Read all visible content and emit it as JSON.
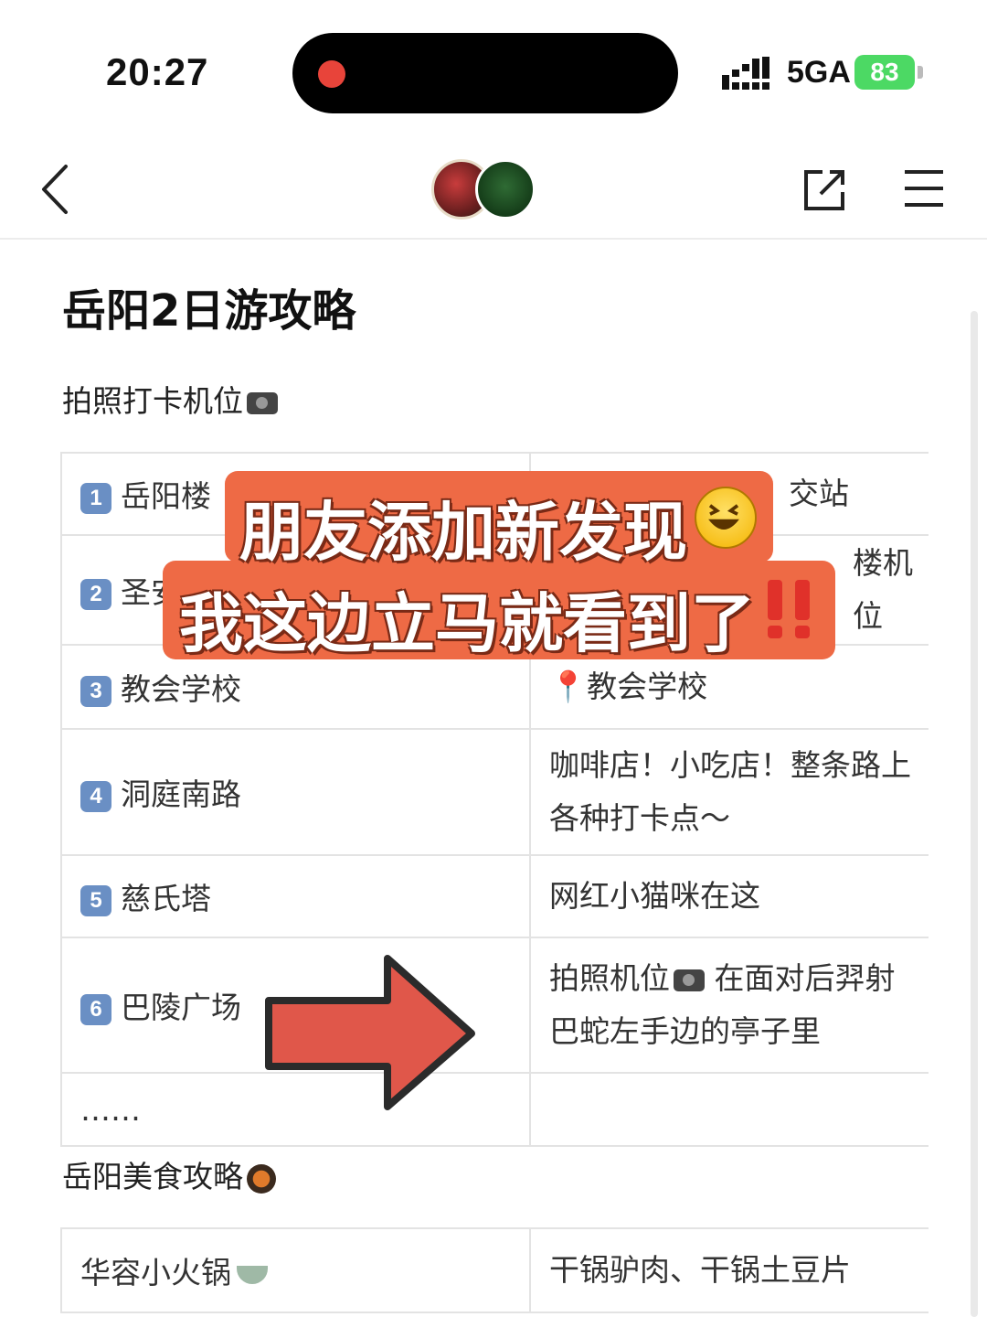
{
  "status": {
    "time": "20:27",
    "network": "5GA",
    "battery": "83"
  },
  "doc": {
    "title": "岳阳2日游攻略",
    "section1": "拍照打卡机位",
    "section2": "岳阳美食攻略"
  },
  "photo_table": [
    {
      "num": "1",
      "place": "岳阳楼",
      "note": "交站"
    },
    {
      "num": "2",
      "place": "圣安",
      "note": "楼机位"
    },
    {
      "num": "3",
      "place": "教会学校",
      "note": "📍教会学校"
    },
    {
      "num": "4",
      "place": "洞庭南路",
      "note": "咖啡店！小吃店！整条路上各种打卡点～"
    },
    {
      "num": "5",
      "place": "慈氏塔",
      "note": "网红小猫咪在这"
    },
    {
      "num": "6",
      "place": "巴陵广场",
      "note_a": "拍照机位",
      "note_b": "在面对后羿射巴蛇左手边的亭子里"
    },
    {
      "place": "……",
      "note": ""
    }
  ],
  "food_table": [
    {
      "place": "华容小火锅",
      "note": "干锅驴肉、干锅土豆片"
    }
  ],
  "overlay": {
    "line1": "朋友添加新发现",
    "line2": "我这边立马就看到了"
  },
  "icons": [
    "back-icon",
    "share-icon",
    "menu-icon",
    "camera-emoji",
    "pot-emoji",
    "bowl-emoji",
    "grin-emoji",
    "double-exclamation-emoji",
    "red-arrow"
  ],
  "colors": {
    "banner": "#ee6a45",
    "arrow": "#e0574a",
    "battery": "#4cd964",
    "badge": "#6a8fc4"
  }
}
